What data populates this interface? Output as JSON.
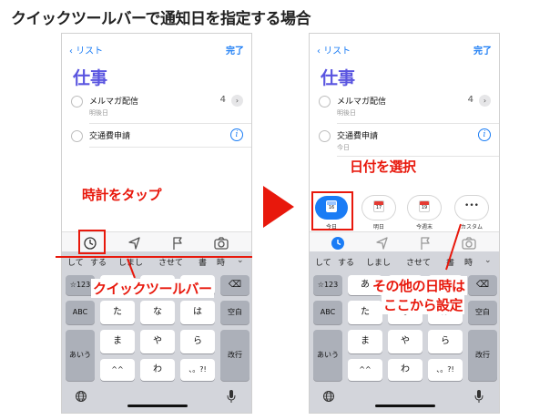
{
  "page": {
    "title": "クイックツールバーで通知日を指定する場合"
  },
  "app": {
    "back_label": "リスト",
    "done_label": "完了",
    "list_title": "仕事",
    "tasks": [
      {
        "title": "メルマガ配信",
        "subtitle": "明後日",
        "count": "4"
      },
      {
        "title": "交通費申請",
        "subtitle": "今日"
      }
    ],
    "accent_color": "#1a7cf5",
    "title_color": "#5a55e0"
  },
  "keyboard": {
    "predictions": [
      "して",
      "する",
      "しまし",
      "させて",
      "書",
      "時"
    ],
    "keys": {
      "mode": "☆123",
      "row1": [
        "あ",
        "か",
        "さ"
      ],
      "row2": [
        "た",
        "な",
        "は"
      ],
      "row3": [
        "ま",
        "や",
        "ら"
      ],
      "row4": [
        "^^",
        "わ",
        "、。?!"
      ],
      "abc": "ABC",
      "space": "空白",
      "aiu": "あいう",
      "enter": "改行",
      "globe": "globe-icon",
      "mic": "mic-icon"
    }
  },
  "quick_toolbar": {
    "shortcuts": [
      {
        "label": "今日",
        "day": "16"
      },
      {
        "label": "明日",
        "day": "17"
      },
      {
        "label": "今週末",
        "day": "19"
      },
      {
        "label": "カスタム",
        "day": "•••"
      }
    ]
  },
  "annotations": {
    "tap_clock": "時計をタップ",
    "quick_toolbar": "クイックツールバー",
    "select_date": "日付を選択",
    "other_date_line1": "その他の日時は",
    "other_date_line2": "ここから設定"
  },
  "colors": {
    "annotation_red": "#e8180c",
    "keyboard_bg": "#d3d5db"
  }
}
